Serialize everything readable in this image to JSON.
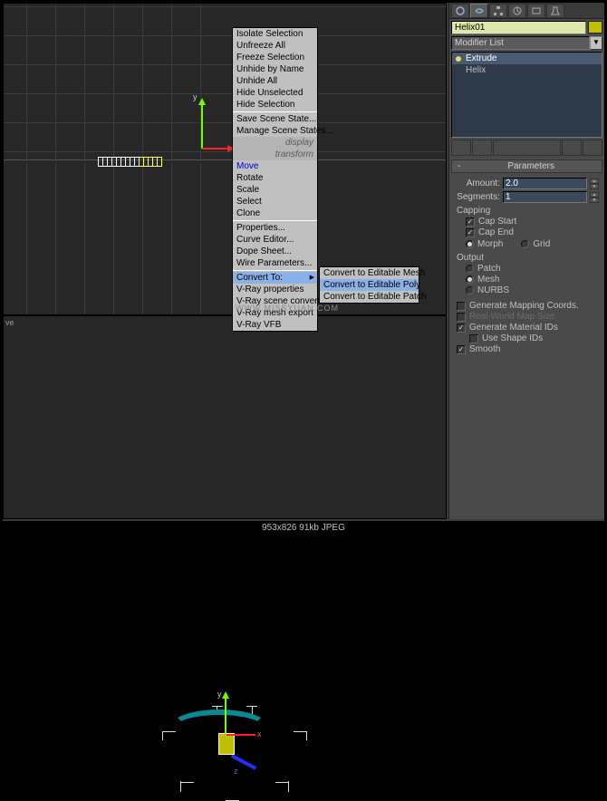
{
  "object_name": "Helix01",
  "modifier_dd": "Modifier List",
  "stack": [
    "Extrude",
    "Helix"
  ],
  "menu": {
    "isolate": "Isolate Selection",
    "unfreeze": "Unfreeze All",
    "freeze": "Freeze Selection",
    "unhide_name": "Unhide by Name",
    "unhide_all": "Unhide All",
    "hide_unsel": "Hide Unselected",
    "hide_sel": "Hide Selection",
    "save_state": "Save Scene State...",
    "manage_state": "Manage Scene States...",
    "hdr_display": "display",
    "hdr_transform": "transform",
    "move": "Move",
    "rotate": "Rotate",
    "scale": "Scale",
    "select": "Select",
    "clone": "Clone",
    "properties": "Properties...",
    "curve": "Curve Editor...",
    "dope": "Dope Sheet...",
    "wire": "Wire Parameters...",
    "convert": "Convert To:",
    "vray_prop": "V-Ray properties",
    "vray_scene": "V-Ray scene converter",
    "vray_mesh": "V-Ray mesh export",
    "vray_vfb": "V-Ray VFB"
  },
  "submenu": {
    "mesh": "Convert to Editable Mesh",
    "poly": "Convert to Editable Poly",
    "patch": "Convert to Editable Patch"
  },
  "rollout": {
    "params": "Parameters",
    "amount_lbl": "Amount:",
    "amount_val": "2.0",
    "segs_lbl": "Segments:",
    "segs_val": "1",
    "capping": "Capping",
    "cap_start": "Cap Start",
    "cap_end": "Cap End",
    "morph": "Morph",
    "grid": "Grid",
    "output": "Output",
    "patch": "Patch",
    "mesh": "Mesh",
    "nurbs": "NURBS",
    "gen_map": "Generate Mapping Coords.",
    "real_world": "Real-World Map Size",
    "gen_mat": "Generate Material IDs",
    "use_shape": "Use Shape IDs",
    "smooth": "Smooth"
  },
  "footer": "953x826   91kb   JPEG",
  "watermark": "WWW.MISSYUAN.COM",
  "axis": {
    "x": "x",
    "y": "y",
    "z": "z"
  }
}
